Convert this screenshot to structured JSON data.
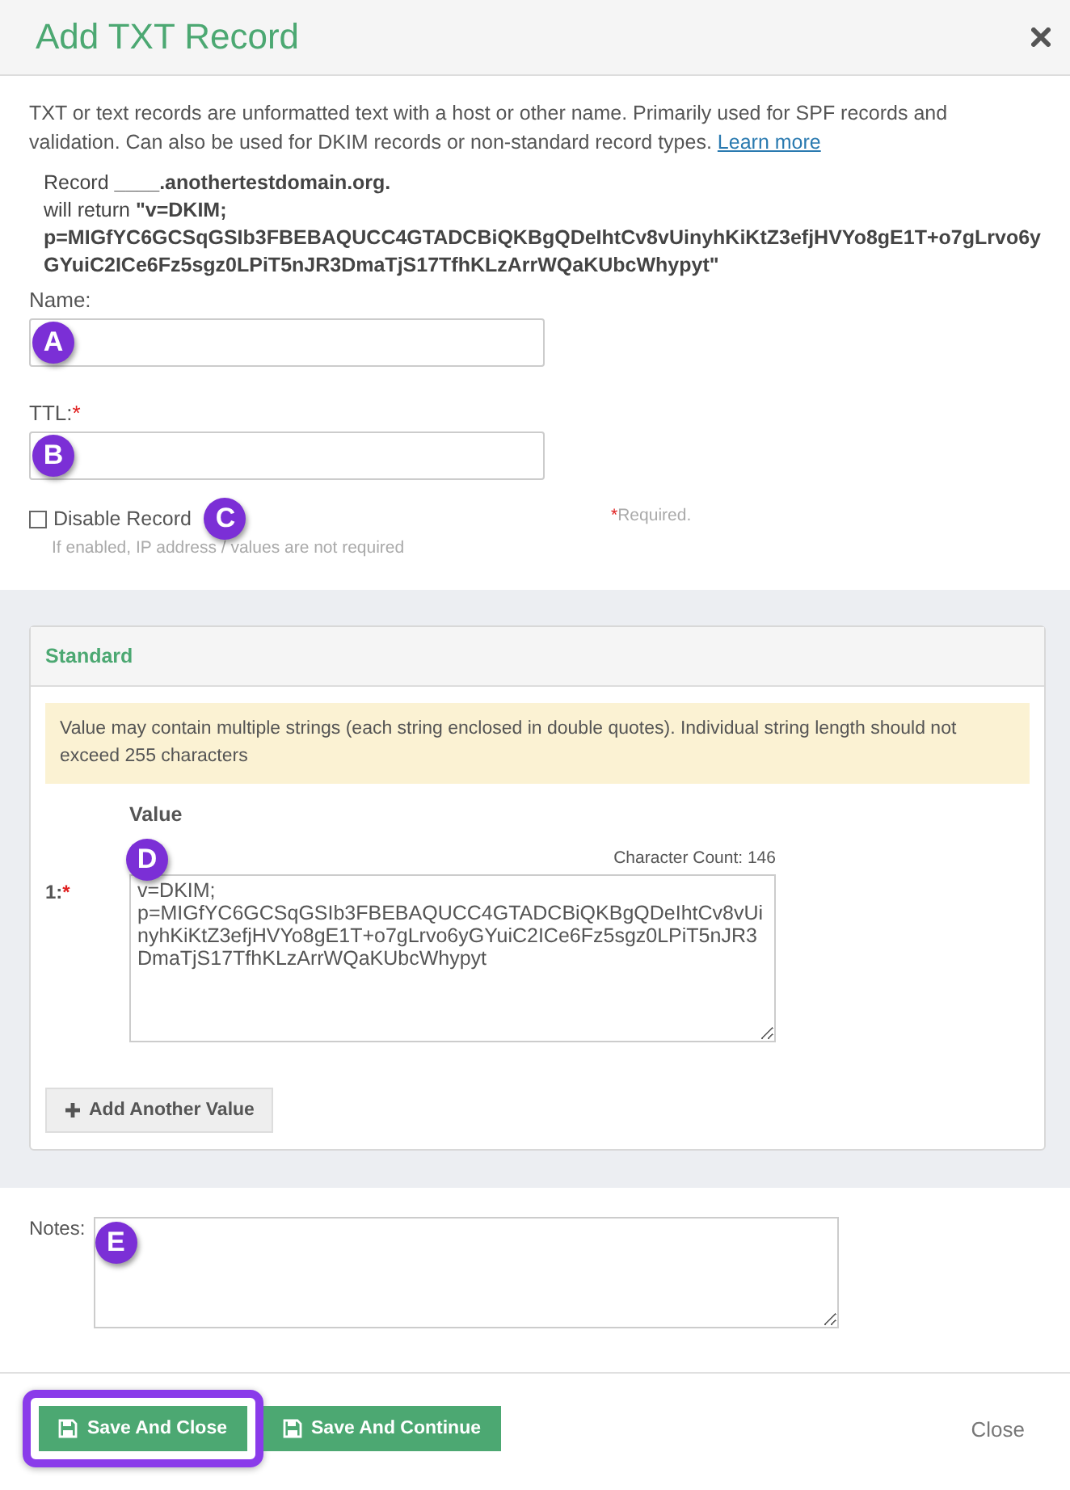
{
  "dialog": {
    "title": "Add TXT Record"
  },
  "intro": {
    "text": "TXT or text records are unformatted text with a host or other name. Primarily used for SPF records and validation. Can also be used for DKIM records or non-standard record types.",
    "link": "Learn more"
  },
  "record_preview": [
    "Record **____.anothertestdomain.org.**",
    "will return **\"v=DKIM;**",
    "**p=MIGfYC6GCSqGSIb3FBEBAQUCC4GTADCBiQKBgQDeIhtCv8vUinyhKiKtZ3efjHVYo8gE1T+o7gLrvo6yGYuiC2ICe6Fz5sgz0LPiT5nJR3DmaTjS17TfhKLzArrWQaKUbcWhypyt\"**"
  ],
  "fields": [
    {
      "label": "Name:",
      "callout": "A"
    },
    {
      "label": "TTL:",
      "required_mark": "*",
      "callout": "B"
    }
  ],
  "disable_record": {
    "label": "Disable Record",
    "checked": false,
    "hint": "If enabled, IP address / values are not required",
    "callout": "C"
  },
  "required_note": {
    "mark": "*",
    "text": "Required."
  },
  "standard": {
    "title": "Standard",
    "notice": "Value may contain multiple strings (each string enclosed in double quotes). Individual string length should not exceed 255 characters",
    "value_heading": "Value",
    "rows": [
      {
        "index": "1:",
        "required_mark": "*",
        "count": "Character Count: 146",
        "value": "v=DKIM;\np=MIGfYC6GCSqGSIb3FBEBAQUCC4GTADCBiQKBgQDeIhtCv8vUinyhKiKtZ3efjHVYo8gE1T+o7gLrvo6yGYuiC2ICe6Fz5sgz0LPiT5nJR3DmaTjS17TfhKLzArrWQaKUbcWhypyt",
        "callout": "D"
      }
    ],
    "add_button": "Add Another Value"
  },
  "notes": {
    "label": "Notes:",
    "callout": "E"
  },
  "footer": {
    "buttons": [
      {
        "label": "Save And Close",
        "highlighted": true
      },
      {
        "label": "Save And Continue",
        "highlighted": false
      }
    ],
    "close_link": "Close"
  }
}
